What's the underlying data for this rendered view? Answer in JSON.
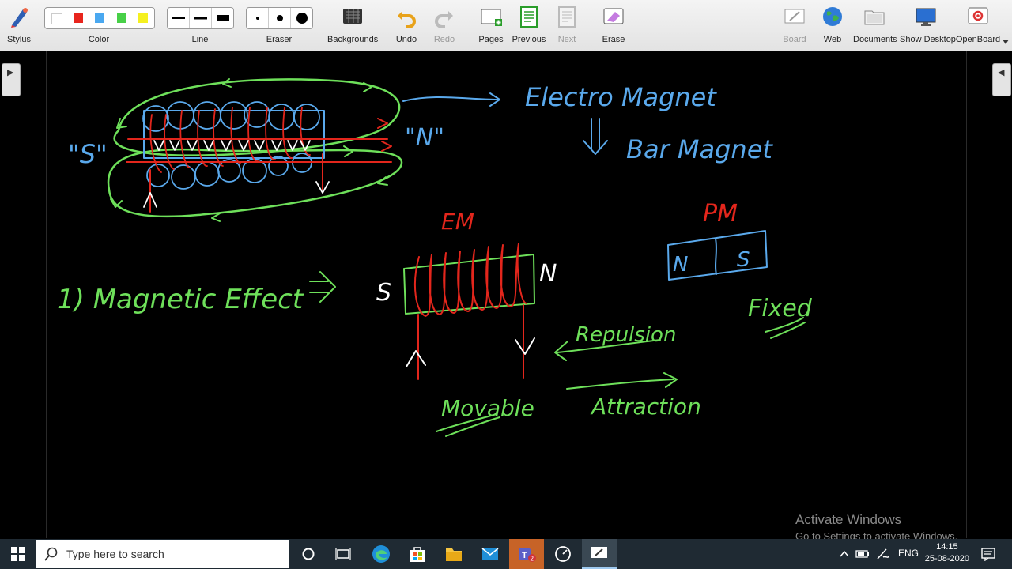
{
  "toolbar": {
    "stylus": "Stylus",
    "color": "Color",
    "line": "Line",
    "eraser": "Eraser",
    "backgrounds": "Backgrounds",
    "undo": "Undo",
    "redo": "Redo",
    "pages": "Pages",
    "previous": "Previous",
    "next": "Next",
    "erase": "Erase",
    "board": "Board",
    "web": "Web",
    "documents": "Documents",
    "show_desktop": "Show Desktop",
    "openboard": "OpenBoard",
    "colors": [
      "#ffffff",
      "#e8251d",
      "#4aa8f0",
      "#48d048",
      "#f5f020"
    ]
  },
  "board": {
    "electro_magnet": "Electro Magnet",
    "bar_magnet": "Bar Magnet",
    "s_quote": "\"S\"",
    "n_quote": "\"N\"",
    "em": "EM",
    "pm": "PM",
    "n_left": "N",
    "s_right": "S",
    "coil_s": "S",
    "coil_n": "N",
    "magnetic_effect": "1) Magnetic Effect",
    "implies": "=>",
    "repulsion": "Repulsion",
    "attraction": "Attraction",
    "movable": "Movable",
    "fixed": "Fixed",
    "ink_colors": {
      "blue": "#5aa9ec",
      "green": "#6ee05a",
      "red": "#e3261c",
      "white": "#ffffff"
    }
  },
  "watermark": {
    "line1": "Activate Windows",
    "line2": "Go to Settings to activate Windows."
  },
  "taskbar": {
    "search_placeholder": "Type here to search",
    "language": "ENG",
    "time": "14:15",
    "date": "25-08-2020"
  }
}
